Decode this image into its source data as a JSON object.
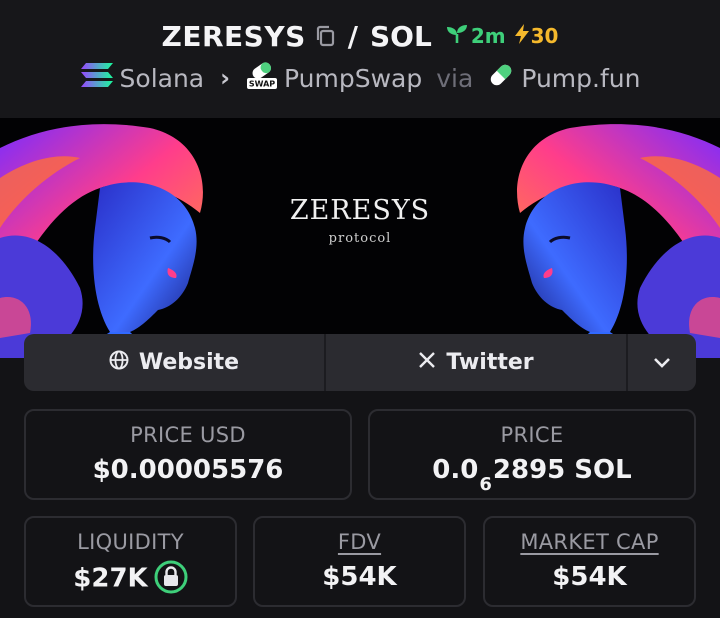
{
  "header": {
    "token_symbol": "ZERESYS",
    "separator": "/",
    "quote_symbol": "SOL",
    "age": "2m",
    "boosts": "30",
    "chain": "Solana",
    "dex": "PumpSwap",
    "via": "via",
    "launchpad": "Pump.fun",
    "dex_icon_text": "SWAP"
  },
  "banner": {
    "title": "ZERESYS",
    "subtitle": "protocol"
  },
  "links": {
    "website_label": "Website",
    "twitter_label": "Twitter"
  },
  "stats": {
    "price_usd": {
      "label": "PRICE USD",
      "value": "$0.00005576"
    },
    "price_native": {
      "label": "PRICE",
      "prefix": "0.0",
      "zero_count": "6",
      "suffix": "2895 SOL"
    },
    "liquidity": {
      "label": "LIQUIDITY",
      "value": "$27K"
    },
    "fdv": {
      "label": "FDV",
      "value": "$54K"
    },
    "market_cap": {
      "label": "MARKET CAP",
      "value": "$54K"
    }
  },
  "colors": {
    "background": "#131316",
    "card_border": "#2c2c31",
    "age_green": "#3ecf7a",
    "boost_yellow": "#f5b92c",
    "lock_green": "#3ecf7a"
  },
  "icons": [
    "copy-icon",
    "seedling-icon",
    "lightning-icon",
    "solana-icon",
    "pumpswap-icon",
    "pill-icon",
    "chevron-right-icon",
    "globe-icon",
    "x-icon",
    "chevron-down-icon",
    "lock-icon"
  ]
}
